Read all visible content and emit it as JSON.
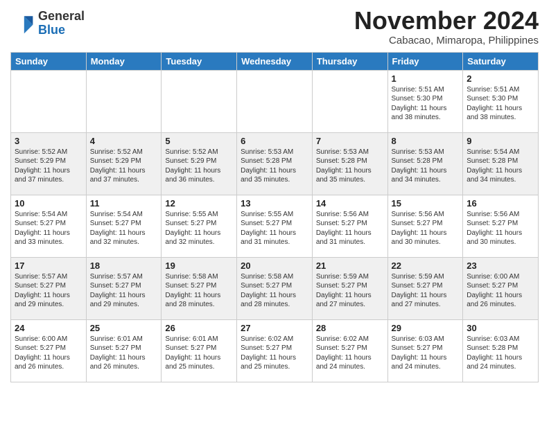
{
  "header": {
    "logo_general": "General",
    "logo_blue": "Blue",
    "month_title": "November 2024",
    "location": "Cabacao, Mimaropa, Philippines"
  },
  "weekdays": [
    "Sunday",
    "Monday",
    "Tuesday",
    "Wednesday",
    "Thursday",
    "Friday",
    "Saturday"
  ],
  "weeks": [
    [
      {
        "day": "",
        "info": ""
      },
      {
        "day": "",
        "info": ""
      },
      {
        "day": "",
        "info": ""
      },
      {
        "day": "",
        "info": ""
      },
      {
        "day": "",
        "info": ""
      },
      {
        "day": "1",
        "info": "Sunrise: 5:51 AM\nSunset: 5:30 PM\nDaylight: 11 hours\nand 38 minutes."
      },
      {
        "day": "2",
        "info": "Sunrise: 5:51 AM\nSunset: 5:30 PM\nDaylight: 11 hours\nand 38 minutes."
      }
    ],
    [
      {
        "day": "3",
        "info": "Sunrise: 5:52 AM\nSunset: 5:29 PM\nDaylight: 11 hours\nand 37 minutes."
      },
      {
        "day": "4",
        "info": "Sunrise: 5:52 AM\nSunset: 5:29 PM\nDaylight: 11 hours\nand 37 minutes."
      },
      {
        "day": "5",
        "info": "Sunrise: 5:52 AM\nSunset: 5:29 PM\nDaylight: 11 hours\nand 36 minutes."
      },
      {
        "day": "6",
        "info": "Sunrise: 5:53 AM\nSunset: 5:28 PM\nDaylight: 11 hours\nand 35 minutes."
      },
      {
        "day": "7",
        "info": "Sunrise: 5:53 AM\nSunset: 5:28 PM\nDaylight: 11 hours\nand 35 minutes."
      },
      {
        "day": "8",
        "info": "Sunrise: 5:53 AM\nSunset: 5:28 PM\nDaylight: 11 hours\nand 34 minutes."
      },
      {
        "day": "9",
        "info": "Sunrise: 5:54 AM\nSunset: 5:28 PM\nDaylight: 11 hours\nand 34 minutes."
      }
    ],
    [
      {
        "day": "10",
        "info": "Sunrise: 5:54 AM\nSunset: 5:27 PM\nDaylight: 11 hours\nand 33 minutes."
      },
      {
        "day": "11",
        "info": "Sunrise: 5:54 AM\nSunset: 5:27 PM\nDaylight: 11 hours\nand 32 minutes."
      },
      {
        "day": "12",
        "info": "Sunrise: 5:55 AM\nSunset: 5:27 PM\nDaylight: 11 hours\nand 32 minutes."
      },
      {
        "day": "13",
        "info": "Sunrise: 5:55 AM\nSunset: 5:27 PM\nDaylight: 11 hours\nand 31 minutes."
      },
      {
        "day": "14",
        "info": "Sunrise: 5:56 AM\nSunset: 5:27 PM\nDaylight: 11 hours\nand 31 minutes."
      },
      {
        "day": "15",
        "info": "Sunrise: 5:56 AM\nSunset: 5:27 PM\nDaylight: 11 hours\nand 30 minutes."
      },
      {
        "day": "16",
        "info": "Sunrise: 5:56 AM\nSunset: 5:27 PM\nDaylight: 11 hours\nand 30 minutes."
      }
    ],
    [
      {
        "day": "17",
        "info": "Sunrise: 5:57 AM\nSunset: 5:27 PM\nDaylight: 11 hours\nand 29 minutes."
      },
      {
        "day": "18",
        "info": "Sunrise: 5:57 AM\nSunset: 5:27 PM\nDaylight: 11 hours\nand 29 minutes."
      },
      {
        "day": "19",
        "info": "Sunrise: 5:58 AM\nSunset: 5:27 PM\nDaylight: 11 hours\nand 28 minutes."
      },
      {
        "day": "20",
        "info": "Sunrise: 5:58 AM\nSunset: 5:27 PM\nDaylight: 11 hours\nand 28 minutes."
      },
      {
        "day": "21",
        "info": "Sunrise: 5:59 AM\nSunset: 5:27 PM\nDaylight: 11 hours\nand 27 minutes."
      },
      {
        "day": "22",
        "info": "Sunrise: 5:59 AM\nSunset: 5:27 PM\nDaylight: 11 hours\nand 27 minutes."
      },
      {
        "day": "23",
        "info": "Sunrise: 6:00 AM\nSunset: 5:27 PM\nDaylight: 11 hours\nand 26 minutes."
      }
    ],
    [
      {
        "day": "24",
        "info": "Sunrise: 6:00 AM\nSunset: 5:27 PM\nDaylight: 11 hours\nand 26 minutes."
      },
      {
        "day": "25",
        "info": "Sunrise: 6:01 AM\nSunset: 5:27 PM\nDaylight: 11 hours\nand 26 minutes."
      },
      {
        "day": "26",
        "info": "Sunrise: 6:01 AM\nSunset: 5:27 PM\nDaylight: 11 hours\nand 25 minutes."
      },
      {
        "day": "27",
        "info": "Sunrise: 6:02 AM\nSunset: 5:27 PM\nDaylight: 11 hours\nand 25 minutes."
      },
      {
        "day": "28",
        "info": "Sunrise: 6:02 AM\nSunset: 5:27 PM\nDaylight: 11 hours\nand 24 minutes."
      },
      {
        "day": "29",
        "info": "Sunrise: 6:03 AM\nSunset: 5:27 PM\nDaylight: 11 hours\nand 24 minutes."
      },
      {
        "day": "30",
        "info": "Sunrise: 6:03 AM\nSunset: 5:28 PM\nDaylight: 11 hours\nand 24 minutes."
      }
    ]
  ]
}
